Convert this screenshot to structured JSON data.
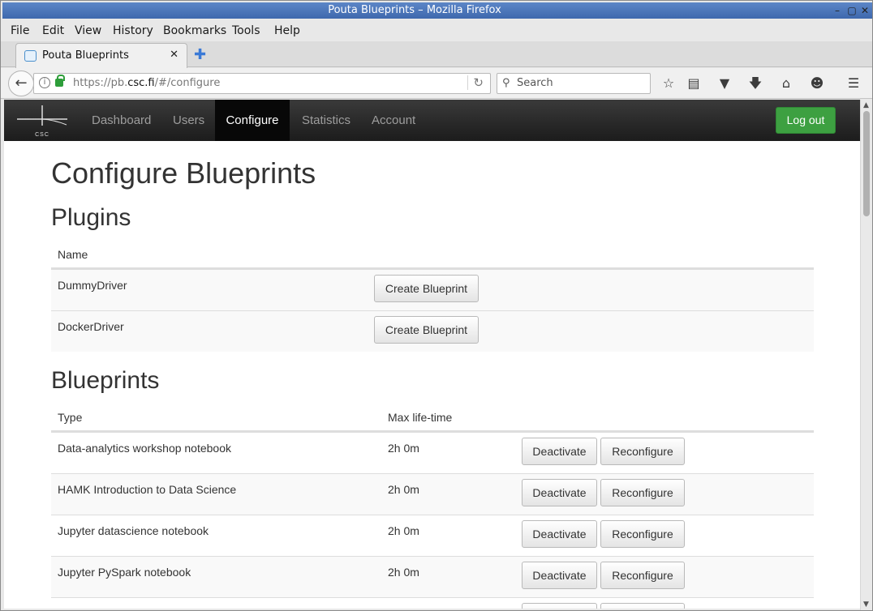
{
  "window": {
    "title": "Pouta Blueprints – Mozilla Firefox",
    "controls": {
      "minimize": "–",
      "maximize": "▢",
      "close": "✕"
    }
  },
  "menubar": [
    "File",
    "Edit",
    "View",
    "History",
    "Bookmarks",
    "Tools",
    "Help"
  ],
  "tab": {
    "title": "Pouta Blueprints",
    "close": "✕",
    "new_tab": "✚"
  },
  "navbar": {
    "url_prefix": "https://pb.",
    "url_domain": "csc.fi",
    "url_path": "/#/configure",
    "search_placeholder": "Search",
    "icons": [
      "star-icon",
      "reading-list-icon",
      "pocket-icon",
      "download-icon",
      "home-icon",
      "chat-icon",
      "menu-icon"
    ]
  },
  "site": {
    "logo_text": "CSC",
    "nav": [
      {
        "label": "Dashboard",
        "active": false
      },
      {
        "label": "Users",
        "active": false
      },
      {
        "label": "Configure",
        "active": true
      },
      {
        "label": "Statistics",
        "active": false
      },
      {
        "label": "Account",
        "active": false
      }
    ],
    "logout_label": "Log out"
  },
  "page": {
    "title": "Configure Blueprints",
    "plugins": {
      "heading": "Plugins",
      "column_name": "Name",
      "rows": [
        {
          "name": "DummyDriver",
          "action": "Create Blueprint"
        },
        {
          "name": "DockerDriver",
          "action": "Create Blueprint"
        }
      ]
    },
    "blueprints": {
      "heading": "Blueprints",
      "columns": [
        "Type",
        "Max life-time"
      ],
      "rows": [
        {
          "type": "Data-analytics workshop notebook",
          "lifetime": "2h 0m",
          "deactivate": "Deactivate",
          "reconfigure": "Reconfigure"
        },
        {
          "type": "HAMK Introduction to Data Science",
          "lifetime": "2h 0m",
          "deactivate": "Deactivate",
          "reconfigure": "Reconfigure"
        },
        {
          "type": "Jupyter datascience notebook",
          "lifetime": "2h 0m",
          "deactivate": "Deactivate",
          "reconfigure": "Reconfigure"
        },
        {
          "type": "Jupyter PySpark notebook",
          "lifetime": "2h 0m",
          "deactivate": "Deactivate",
          "reconfigure": "Reconfigure"
        }
      ]
    }
  },
  "colors": {
    "logout_green": "#3da041",
    "navbar_dark": "#222222",
    "titlebar_blue": "#4a74b9"
  }
}
